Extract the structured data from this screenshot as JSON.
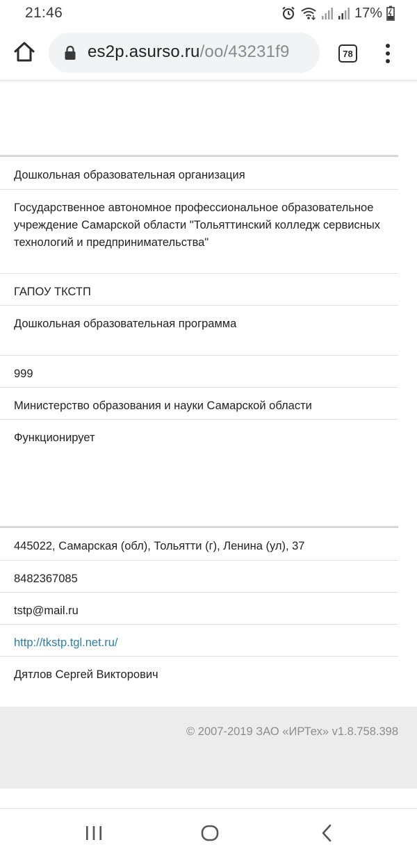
{
  "status_bar": {
    "time": "21:46",
    "battery_percent": "17%",
    "icons": [
      "alarm-icon",
      "wifi-icon",
      "signal-icon",
      "signal-icon-2",
      "battery-charging-icon"
    ]
  },
  "browser": {
    "url_domain": "es2p.asurso.ru",
    "url_path": "/oo/43231f9",
    "tab_count": "78",
    "icons": [
      "home-icon",
      "lock-icon",
      "more-vert-icon"
    ]
  },
  "info_rows": [
    {
      "value": "Дошкольная образовательная организация"
    },
    {
      "value": "Государственное автономное профессиональное образовательное учреждение Самарской области \"Тольяттинский колледж сервисных технологий и предпринимательства\""
    },
    {
      "value": "ГАПОУ ТКСТП"
    },
    {
      "value": "Дошкольная образовательная программа"
    },
    {
      "value": "999"
    },
    {
      "value": "Министерство образования и науки Самарской области"
    },
    {
      "value": "Функционирует"
    }
  ],
  "contact_rows": [
    {
      "value": "445022, Самарская (обл), Тольятти (г), Ленина (ул), 37"
    },
    {
      "value": "8482367085"
    },
    {
      "value": "tstp@mail.ru"
    },
    {
      "value": "http://tkstp.tgl.net.ru/"
    },
    {
      "value": "Дятлов Сергей Викторович"
    }
  ],
  "footer": {
    "copyright": "© 2007-2019 ЗАО «ИРТех» v1.8.758.398"
  },
  "colors": {
    "link": "#2a7fa8",
    "footer_bg": "#ececec",
    "url_pill_bg": "#f1f3f4"
  },
  "navbar": {
    "icons": [
      "recents-icon",
      "home-circle-icon",
      "back-icon"
    ]
  }
}
